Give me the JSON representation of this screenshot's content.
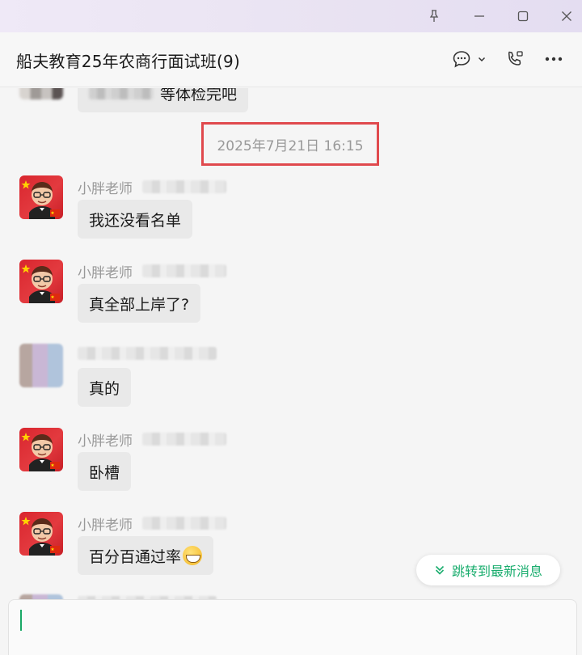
{
  "window": {
    "pin_icon": "pin-icon",
    "minimize_icon": "minimize-icon",
    "maximize_icon": "maximize-icon",
    "close_icon": "close-icon"
  },
  "header": {
    "title": "船夫教育25年农商行面试班(9)",
    "icons": [
      "chat-bubble-icon",
      "chevron-down-icon",
      "video-call-icon",
      "more-icon"
    ]
  },
  "messages": {
    "prev_message_suffix": "等体检完吧",
    "timestamp": "2025年7月21日 16:15",
    "items": [
      {
        "sender": "小胖老师",
        "text": "我还没看名单"
      },
      {
        "sender": "小胖老师",
        "text": "真全部上岸了?"
      },
      {
        "sender": "",
        "text": "真的"
      },
      {
        "sender": "小胖老师",
        "text": "卧槽"
      },
      {
        "sender": "小胖老师",
        "text": "百分百通过率"
      }
    ]
  },
  "jump_button": {
    "label": "跳转到最新消息"
  },
  "colors": {
    "accent": "#1aad6e",
    "highlight_border": "#e0494d"
  }
}
